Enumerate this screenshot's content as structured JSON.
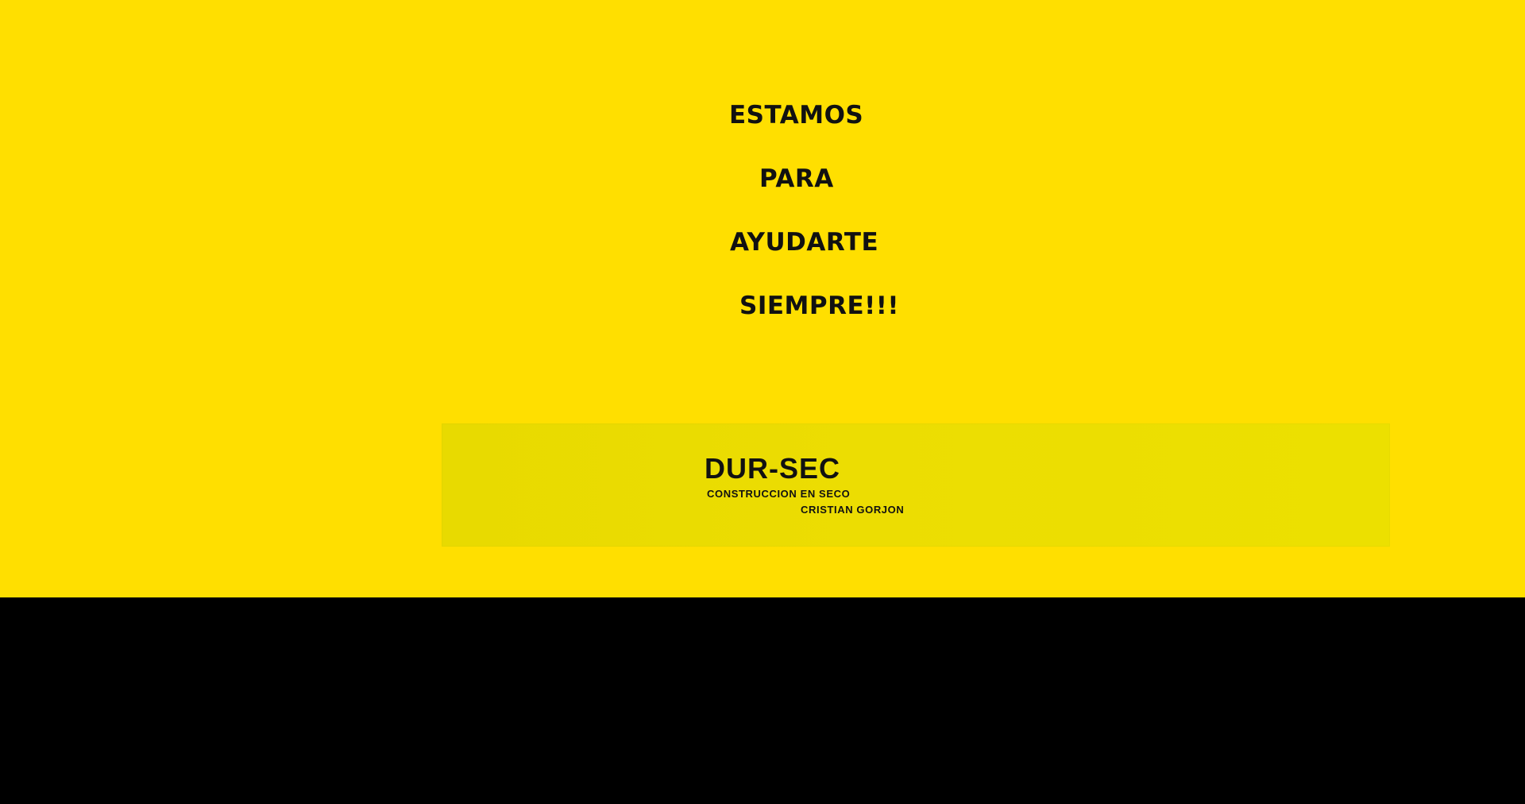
{
  "colors": {
    "primary_yellow": "#ffdf00",
    "banner_yellow": "#ecdd02",
    "text_dark": "#111111",
    "footer_black": "#000000"
  },
  "slogan": {
    "lines": [
      "ESTAMOS",
      "PARA",
      "AYUDARTE",
      "SIEMPRE!!!"
    ]
  },
  "logo": {
    "name": "DUR-SEC",
    "tagline": "CONSTRUCCION EN SECO",
    "owner": "CRISTIAN GORJON"
  }
}
